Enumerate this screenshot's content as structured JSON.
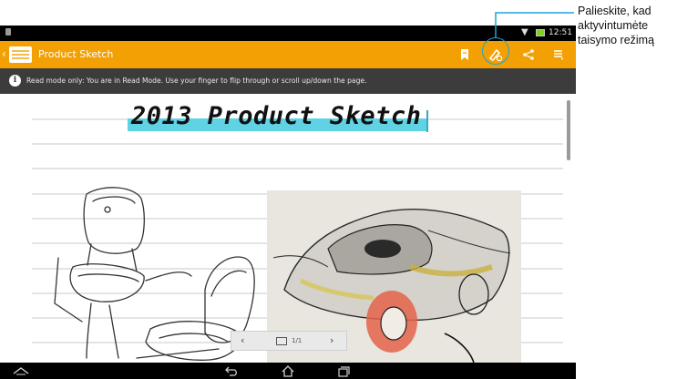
{
  "status_bar": {
    "time": "12:51",
    "wifi_icon": "wifi-icon",
    "battery_icon": "battery-icon"
  },
  "action_bar": {
    "title": "Product Sketch",
    "background": "#f2a003",
    "buttons": [
      "bookmark-icon",
      "edit-mode-icon",
      "share-icon",
      "menu-icon"
    ]
  },
  "banner": {
    "message": "Read mode only: You are in Read Mode. Use your finger to flip through or scroll up/down the page."
  },
  "page": {
    "title": "2013 Product Sketch"
  },
  "pager": {
    "prev": "‹",
    "next": "›",
    "page_number": "1/1"
  },
  "callout": {
    "text": "Palieskite, kad aktyvintumėte taisymo režimą",
    "color": "#1aa6d8"
  },
  "nav_bar": {
    "buttons": [
      "collapse-icon",
      "back-icon",
      "home-icon",
      "recent-apps-icon"
    ]
  }
}
